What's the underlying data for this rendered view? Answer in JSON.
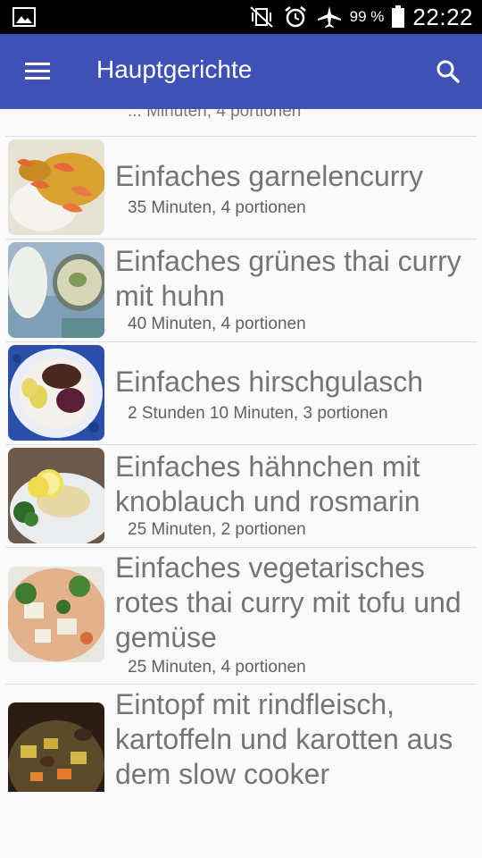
{
  "status_bar": {
    "battery_percent": "99 %",
    "time": "22:22",
    "icons": [
      "picture-icon",
      "vibrate-icon",
      "alarm-icon",
      "airplane-icon",
      "battery-icon"
    ]
  },
  "app_bar": {
    "title": "Hauptgerichte",
    "menu_icon": "menu-icon",
    "search_icon": "search-icon"
  },
  "list": {
    "cut_off_text": "... Minuten, 4 portionen",
    "items": [
      {
        "name": "Einfaches garnelencurry",
        "meta": "35 Minuten, 4 portionen",
        "thumb": "shrimp-curry"
      },
      {
        "name": "Einfaches grünes thai curry mit huhn",
        "meta": "40 Minuten, 4 portionen",
        "thumb": "green-curry"
      },
      {
        "name": "Einfaches hirschgulasch",
        "meta": "2 Stunden 10 Minuten, 3 portionen",
        "thumb": "venison-goulash"
      },
      {
        "name": "Einfaches hähnchen mit knoblauch und rosmarin",
        "meta": "25 Minuten, 2 portionen",
        "thumb": "garlic-chicken"
      },
      {
        "name": "Einfaches vegetarisches rotes thai curry mit tofu und gemüse",
        "meta": "25 Minuten, 4 portionen",
        "thumb": "tofu-curry"
      },
      {
        "name": "Eintopf mit rindfleisch, kartoffeln und karotten aus dem slow cooker",
        "meta": "",
        "thumb": "beef-stew"
      }
    ]
  }
}
